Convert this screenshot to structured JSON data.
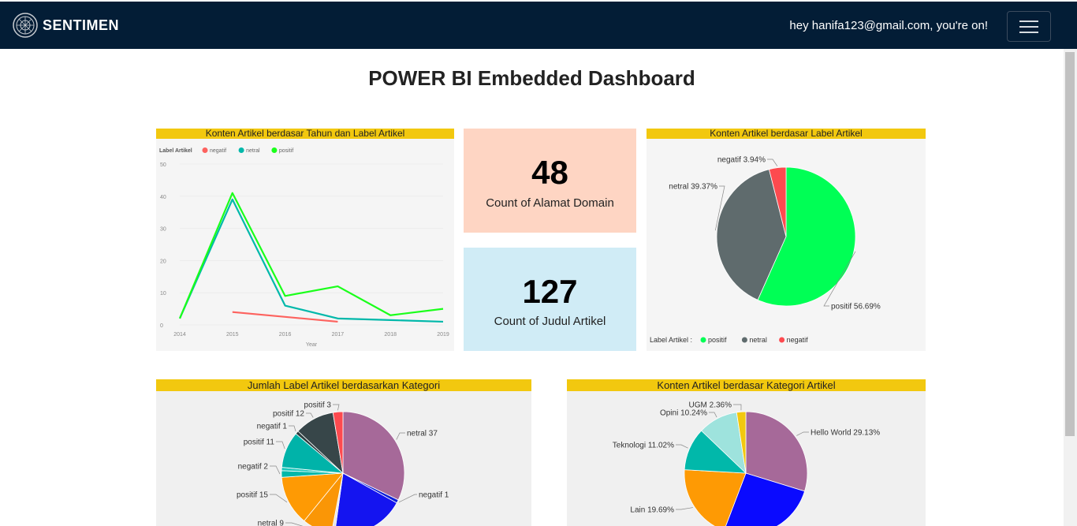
{
  "navbar": {
    "brand": "SENTIMEN",
    "greeting": "hey hanifa123@gmail.com, you're on!"
  },
  "page_title": "POWER BI Embedded Dashboard",
  "cards": {
    "domain": {
      "value": "48",
      "label": "Count of Alamat Domain"
    },
    "judul": {
      "value": "127",
      "label": "Count of Judul Artikel"
    }
  },
  "panels": {
    "line": {
      "title": "Konten Artikel berdasar Tahun dan Label Artikel",
      "legend_title": "Label Artikel"
    },
    "pie_label": {
      "title": "Konten Artikel berdasar Label Artikel",
      "legend_title": "Label Artikel :"
    },
    "pie_kategori_label": {
      "title": "Jumlah Label Artikel berdasarkan Kategori"
    },
    "pie_kategori": {
      "title": "Konten Artikel berdasar Kategori Artikel"
    }
  },
  "chart_data": [
    {
      "type": "line",
      "title": "Konten Artikel berdasar Tahun dan Label Artikel",
      "xlabel": "Year",
      "ylabel": "",
      "x": [
        2014,
        2015,
        2016,
        2017,
        2018,
        2019
      ],
      "ylim": [
        0,
        50
      ],
      "yticks": [
        0,
        10,
        20,
        30,
        40,
        50
      ],
      "legend": "top-left",
      "series": [
        {
          "name": "negatif",
          "color": "#fd625e",
          "values": [
            null,
            4,
            null,
            1,
            null,
            null
          ]
        },
        {
          "name": "netral",
          "color": "#01b8aa",
          "values": [
            2,
            39,
            6,
            2,
            1.5,
            1
          ]
        },
        {
          "name": "positif",
          "color": "#1aff1a",
          "values": [
            2,
            41,
            9,
            12,
            3,
            5
          ]
        }
      ]
    },
    {
      "type": "pie",
      "title": "Konten Artikel berdasar Label Artikel",
      "legend": "bottom-left",
      "slices": [
        {
          "name": "positif",
          "value": 56.69,
          "label": "positif 56.69%",
          "color": "#00ff55"
        },
        {
          "name": "netral",
          "value": 39.37,
          "label": "netral 39.37%",
          "color": "#5f6b6d"
        },
        {
          "name": "negatif",
          "value": 3.94,
          "label": "negatif 3.94%",
          "color": "#fd4a4f"
        }
      ]
    },
    {
      "type": "pie",
      "title": "Jumlah Label Artikel berdasarkan Kategori",
      "slices": [
        {
          "value": 37,
          "label": "netral 37",
          "color": "#a66999"
        },
        {
          "value": 1,
          "label": "negatif 1",
          "color": "#0c1fd6"
        },
        {
          "value": 22,
          "label": "",
          "color": "#1414f0"
        },
        {
          "value": 1,
          "label": "",
          "color": "#e6e6e6"
        },
        {
          "value": 9,
          "label": "netral 9",
          "color": "#fa9606"
        },
        {
          "value": 15,
          "label": "positif 15",
          "color": "#fe9a04"
        },
        {
          "value": 2,
          "label": "negatif 2",
          "color": "#01b8aa"
        },
        {
          "value": 1,
          "label": "",
          "color": "#19c7ba"
        },
        {
          "value": 11,
          "label": "positif 11",
          "color": "#00b3a9"
        },
        {
          "value": 1,
          "label": "negatif 1",
          "color": "#2c3e40"
        },
        {
          "value": 12,
          "label": "positif 12",
          "color": "#374649"
        },
        {
          "value": 3,
          "label": "positif 3",
          "color": "#fd4a4f"
        }
      ]
    },
    {
      "type": "pie",
      "title": "Konten Artikel berdasar Kategori Artikel",
      "slices": [
        {
          "value": 29.13,
          "label": "Hello World 29.13%",
          "color": "#a66999"
        },
        {
          "value": 25.52,
          "label": "",
          "color": "#0a0aff"
        },
        {
          "value": 19.69,
          "label": "Lain 19.69%",
          "color": "#fe9a04"
        },
        {
          "value": 11.02,
          "label": "Teknologi 11.02%",
          "color": "#01b8aa"
        },
        {
          "value": 10.24,
          "label": "Opini 10.24%",
          "color": "#9ee3dd"
        },
        {
          "value": 2.36,
          "label": "UGM 2.36%",
          "color": "#f2c80f"
        }
      ]
    }
  ]
}
